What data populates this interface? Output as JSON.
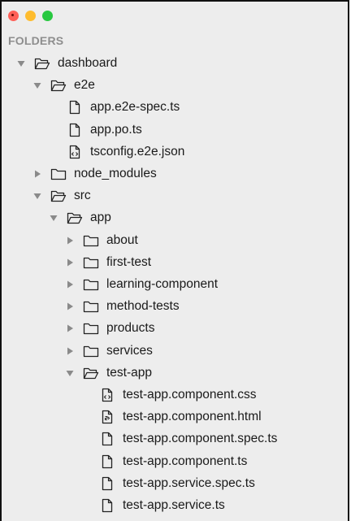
{
  "window": {
    "buttons": {
      "close_color": "#ff5f57",
      "minimize_color": "#febc2e",
      "maximize_color": "#28c840"
    }
  },
  "sidebar": {
    "header": "FOLDERS",
    "tree": [
      {
        "label": "dashboard",
        "kind": "folder",
        "expanded": true,
        "depth": 0
      },
      {
        "label": "e2e",
        "kind": "folder",
        "expanded": true,
        "depth": 1
      },
      {
        "label": "app.e2e-spec.ts",
        "kind": "file",
        "icon": "file-icon",
        "depth": 2
      },
      {
        "label": "app.po.ts",
        "kind": "file",
        "icon": "file-icon",
        "depth": 2
      },
      {
        "label": "tsconfig.e2e.json",
        "kind": "file",
        "icon": "code-file-icon",
        "depth": 2
      },
      {
        "label": "node_modules",
        "kind": "folder",
        "expanded": false,
        "depth": 1
      },
      {
        "label": "src",
        "kind": "folder",
        "expanded": true,
        "depth": 1
      },
      {
        "label": "app",
        "kind": "folder",
        "expanded": true,
        "depth": 2
      },
      {
        "label": "about",
        "kind": "folder",
        "expanded": false,
        "depth": 3
      },
      {
        "label": "first-test",
        "kind": "folder",
        "expanded": false,
        "depth": 3
      },
      {
        "label": "learning-component",
        "kind": "folder",
        "expanded": false,
        "depth": 3
      },
      {
        "label": "method-tests",
        "kind": "folder",
        "expanded": false,
        "depth": 3
      },
      {
        "label": "products",
        "kind": "folder",
        "expanded": false,
        "depth": 3
      },
      {
        "label": "services",
        "kind": "folder",
        "expanded": false,
        "depth": 3
      },
      {
        "label": "test-app",
        "kind": "folder",
        "expanded": true,
        "depth": 3
      },
      {
        "label": "test-app.component.css",
        "kind": "file",
        "icon": "code-file-icon",
        "depth": 4
      },
      {
        "label": "test-app.component.html",
        "kind": "file",
        "icon": "markup-file-icon",
        "depth": 4
      },
      {
        "label": "test-app.component.spec.ts",
        "kind": "file",
        "icon": "file-icon",
        "depth": 4
      },
      {
        "label": "test-app.component.ts",
        "kind": "file",
        "icon": "file-icon",
        "depth": 4
      },
      {
        "label": "test-app.service.spec.ts",
        "kind": "file",
        "icon": "file-icon",
        "depth": 4
      },
      {
        "label": "test-app.service.ts",
        "kind": "file",
        "icon": "file-icon",
        "depth": 4
      }
    ]
  }
}
